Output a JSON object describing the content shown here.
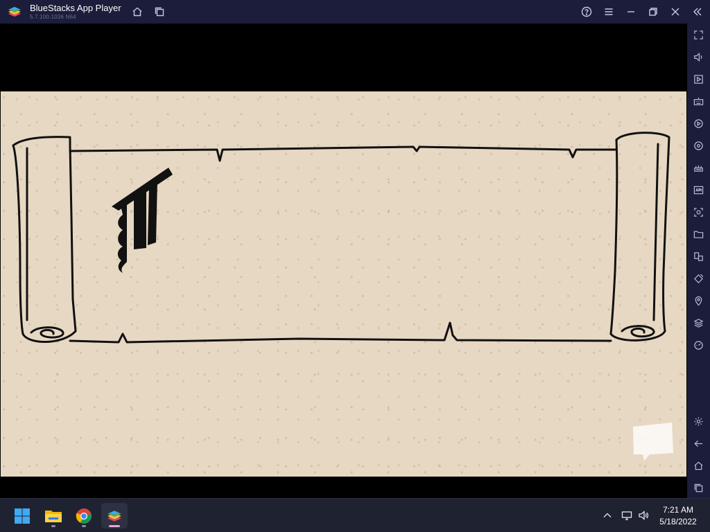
{
  "titlebar": {
    "app_title": "BlueStacks App Player",
    "app_version": "5.7.100.1036 N64",
    "icons": [
      "bluestacks-logo-icon",
      "home-icon",
      "multi-instance-icon",
      "help-icon",
      "menu-icon",
      "minimize-icon",
      "restore-icon",
      "close-icon",
      "collapse-sidebar-icon"
    ]
  },
  "game": {
    "scene": "parchment-scroll",
    "colors": {
      "paper": "#e7d8c3",
      "ink": "#111111"
    }
  },
  "sidebar": {
    "icons": [
      "fullscreen-icon",
      "volume-icon",
      "media-manager-icon",
      "keyboard-controls-icon",
      "macro-recorder-icon",
      "sync-icon",
      "game-controls-icon",
      "apk-install-icon",
      "screenshot-icon",
      "folder-icon",
      "multi-instance-manager-icon",
      "rotate-icon",
      "location-icon",
      "layers-icon",
      "performance-icon",
      "settings-icon",
      "back-icon",
      "home-icon",
      "recent-apps-icon"
    ]
  },
  "taskbar": {
    "apps": [
      "windows-start-icon",
      "file-explorer-icon",
      "chrome-icon",
      "bluestacks-icon"
    ],
    "tray_icons": [
      "show-hidden-icons-icon",
      "network-icon",
      "speaker-icon"
    ],
    "clock": {
      "time": "7:21 AM",
      "date": "5/18/2022"
    }
  },
  "colors": {
    "titlebar_bg": "#1b1d3a",
    "taskbar_bg": "#1f2230",
    "accent": "#e6a6d8"
  }
}
